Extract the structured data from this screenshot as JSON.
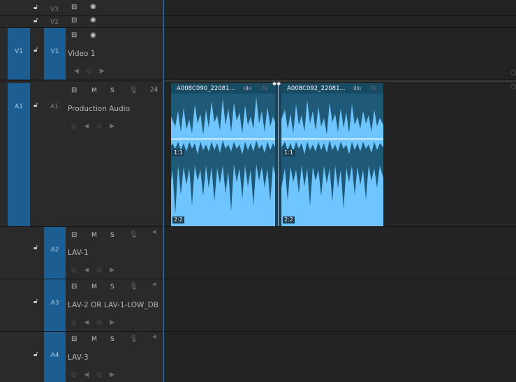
{
  "tracks": {
    "v3": {
      "target": "V3"
    },
    "v2": {
      "target": "V2"
    },
    "v1": {
      "source": "V1",
      "target": "V1",
      "name": "Video 1"
    },
    "a1": {
      "source": "A1",
      "target": "A1",
      "name": "Production Audio",
      "volume": "24"
    },
    "a2": {
      "target": "A2",
      "name": "LAV-1"
    },
    "a3": {
      "target": "A3",
      "name": "LAV-2 OR LAV-1-LOW_DB"
    },
    "a4": {
      "target": "A4",
      "name": "LAV-3"
    }
  },
  "buttons": {
    "mute": "M",
    "solo": "S"
  },
  "clips": [
    {
      "name": "A008C090_22081...",
      "fx": "fx",
      "ch1": "1:1",
      "ch2": "2:2"
    },
    {
      "name": "A008C092_22081...",
      "fx": "fx",
      "ch1": "1:1",
      "ch2": "2:2"
    }
  ],
  "icons": {
    "lock": "lock-icon",
    "eye": "eye-icon",
    "sync": "sync-icon",
    "mic": "mic-icon",
    "keyframe": "keyframe-nav-icon"
  },
  "colors": {
    "panel_bg": "#232323",
    "header_bg": "#2a2a2a",
    "target_blue": "#1c5e91",
    "clip_top": "#1e5a78",
    "waveform": "#6ec5ff",
    "playhead": "#3a7bbf"
  }
}
